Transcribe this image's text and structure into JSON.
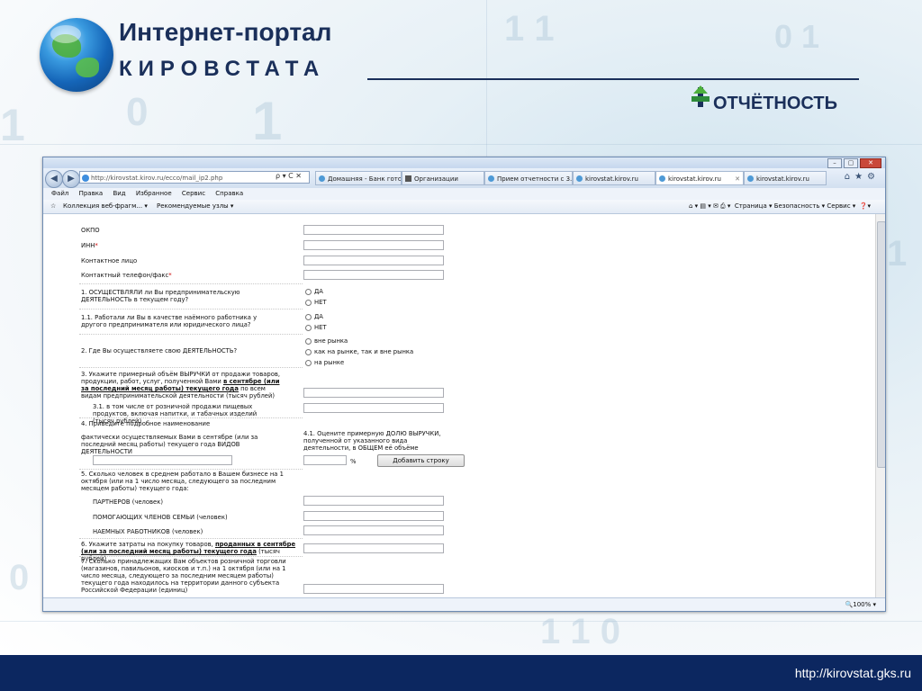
{
  "slide": {
    "title_line1": "Интернет-портал",
    "title_line2": "КИРОВСТАТА",
    "report_label": "ОТЧЁТНОСТЬ",
    "footer_url": "http://kirovstat.gks.ru",
    "colors": {
      "navy": "#1a2f5a",
      "footer": "#0c2760"
    }
  },
  "browser": {
    "address": "http://kirovstat.kirov.ru/ecco/mail_ip2.php",
    "address_controls": "ρ ▾ C ✕",
    "tabs": [
      {
        "label": "Домашняя - Банк гото..."
      },
      {
        "label": "Организации"
      },
      {
        "label": "Прием отчетности с 3..."
      },
      {
        "label": "kirovstat.kirov.ru"
      },
      {
        "label": "kirovstat.kirov.ru"
      },
      {
        "label": "kirovstat.kirov.ru"
      }
    ],
    "menu": [
      "Файл",
      "Правка",
      "Вид",
      "Избранное",
      "Сервис",
      "Справка"
    ],
    "favorites": [
      "Коллекция веб-фрагм... ▾",
      "Рекомендуемые узлы ▾"
    ],
    "command_bar": "Страница ▾   Безопасность ▾   Сервис ▾",
    "zoom": "100%"
  },
  "form": {
    "okpo": "ОКПО",
    "inn": "ИНН",
    "contact_person": "Контактное лицо",
    "contact_phone": "Контактный телефон/факс",
    "required_mark": "*",
    "q1": "1. ОСУЩЕСТВЛЯЛИ ли Вы предпринимательскую ДЕЯТЕЛЬНОСТЬ в текущем году?",
    "q1_1": "1.1. Работали ли Вы в качестве наёмного работника у другого предпринимателя или юридического лица?",
    "yes": "ДА",
    "no": "НЕТ",
    "q2": "2. Где Вы осуществляете свою ДЕЯТЕЛЬНОСТЬ?",
    "q2_options": [
      "вне рынка",
      "как на рынке, так и вне рынка",
      "на рынке"
    ],
    "q3_a": "3. Укажите примерный объём ВЫРУЧКИ от продажи товаров, продукции, работ, услуг, полученной Вами ",
    "q3_b": "в сентябре (или за последний месяц работы) текущего года",
    "q3_c": " по всем видам предпринимательской деятельности (тысяч рублей)",
    "q3_1": "3.1. в том числе от розничной продажи пищевых продуктов, включая напитки, и табачных изделий (тысяч рублей)",
    "q4_title": "4. Приведите подробное наименование",
    "q4_text": "фактически осуществляемых Вами в сентябре (или за последний месяц работы) текущего года ВИДОВ ДЕЯТЕЛЬНОСТИ",
    "q4_1": "4.1. Оцените примерную ДОЛЮ ВЫРУЧКИ, полученной от указанного вида деятельности, в ОБЩЕМ её объёме",
    "percent": "%",
    "add_row": "Добавить строку",
    "q5": "5. Сколько человек в среднем работало в Вашем бизнесе на 1 октября (или на 1 число месяца, следующего за последним месяцем работы) текущего года:",
    "q5_partners": "ПАРТНЕРОВ (человек)",
    "q5_family": "ПОМОГАЮЩИХ ЧЛЕНОВ СЕМЬИ (человек)",
    "q5_hired": "НАЕМНЫХ РАБОТНИКОВ (человек)",
    "q6_a": "6. Укажите затраты на покупку товаров, ",
    "q6_b": "проданных в сентябре (или за последний месяц работы) текущего года",
    "q6_c": " (тысяч рублей)",
    "q7": "7. Сколько принадлежащих Вам объектов розничной торговли (магазинов, павильонов, киосков и т.п.) на 1 октября (или на 1 число месяца, следующего за последним месяцем работы) текущего года находилось на территории данного субъекта Российской Федерации (единиц)"
  }
}
